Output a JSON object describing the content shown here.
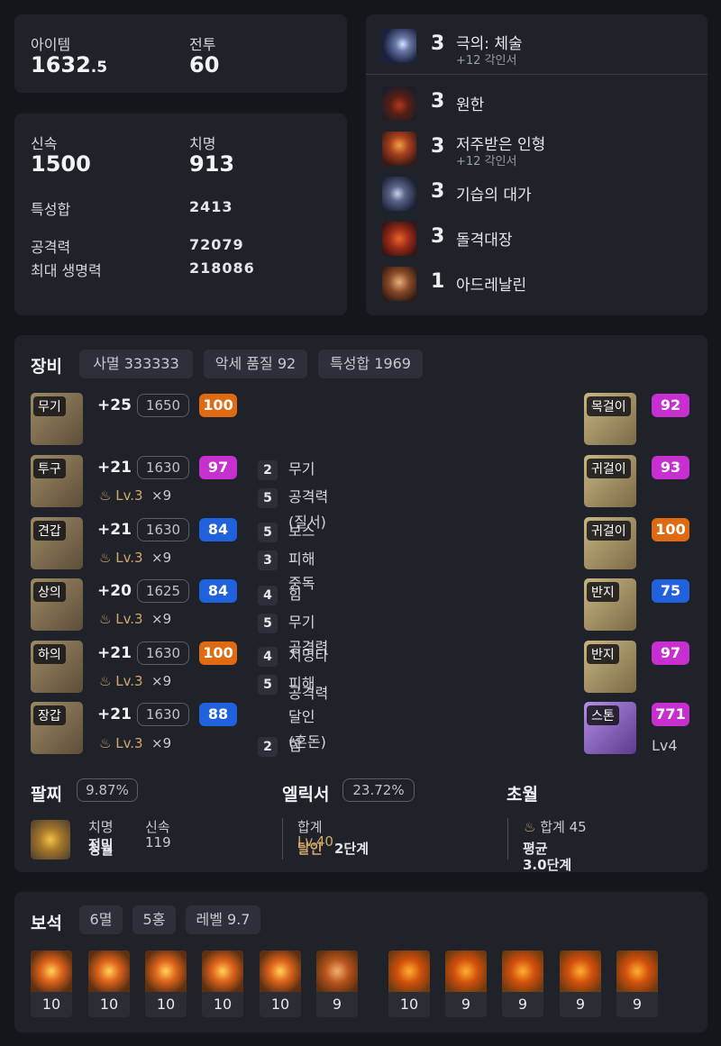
{
  "summary": {
    "item_label": "아이템",
    "item_value": "1632",
    "item_decimal": ".5",
    "combat_label": "전투",
    "combat_value": "60"
  },
  "stats": {
    "swift_label": "신속",
    "swift_value": "1500",
    "crit_label": "치명",
    "crit_value": "913",
    "trait_label": "특성합",
    "trait_value": "2413",
    "atk_label": "공격력",
    "atk_value": "72079",
    "hp_label": "최대 생명력",
    "hp_value": "218086"
  },
  "engravings": [
    {
      "level": "3",
      "name": "극의: 체술",
      "sub": "+12 각인서",
      "icon": "martial-arts-icon"
    },
    {
      "level": "3",
      "name": "원한",
      "sub": "",
      "icon": "grudge-icon"
    },
    {
      "level": "3",
      "name": "저주받은 인형",
      "sub": "+12 각인서",
      "icon": "cursed-doll-icon"
    },
    {
      "level": "3",
      "name": "기습의 대가",
      "sub": "",
      "icon": "ambush-icon"
    },
    {
      "level": "3",
      "name": "돌격대장",
      "sub": "",
      "icon": "charge-icon"
    },
    {
      "level": "1",
      "name": "아드레날린",
      "sub": "",
      "icon": "adrenaline-icon"
    }
  ],
  "equipment": {
    "title": "장비",
    "chips": [
      "사멸 333333",
      "악세 품질 92",
      "특성합 1969"
    ],
    "armor": [
      {
        "slot": "무기",
        "enhance": "+25",
        "ilvl": "1650",
        "quality": "100",
        "elixir": "",
        "count": ""
      },
      {
        "slot": "투구",
        "enhance": "+21",
        "ilvl": "1630",
        "quality": "97",
        "elixir": "Lv.3",
        "count": "×9"
      },
      {
        "slot": "견갑",
        "enhance": "+21",
        "ilvl": "1630",
        "quality": "84",
        "elixir": "Lv.3",
        "count": "×9"
      },
      {
        "slot": "상의",
        "enhance": "+20",
        "ilvl": "1625",
        "quality": "84",
        "elixir": "Lv.3",
        "count": "×9"
      },
      {
        "slot": "하의",
        "enhance": "+21",
        "ilvl": "1630",
        "quality": "100",
        "elixir": "Lv.3",
        "count": "×9"
      },
      {
        "slot": "장갑",
        "enhance": "+21",
        "ilvl": "1630",
        "quality": "88",
        "elixir": "Lv.3",
        "count": "×9"
      }
    ],
    "effects": [
      {
        "lv": "2",
        "name": "무기"
      },
      {
        "lv": "5",
        "name": "공격력"
      },
      {
        "lv": "",
        "name": "(질서)"
      },
      {
        "lv": "5",
        "name": "보스"
      },
      {
        "lv": "3",
        "name": "피해"
      },
      {
        "lv": "",
        "name": "중독"
      },
      {
        "lv": "4",
        "name": "힘"
      },
      {
        "lv": "5",
        "name": "무기"
      },
      {
        "lv": "",
        "name": "공격력"
      },
      {
        "lv": "4",
        "name": "치명타"
      },
      {
        "lv": "5",
        "name": "피해"
      },
      {
        "lv": "",
        "name": "공격력"
      },
      {
        "lv": "5",
        "name": "달인"
      },
      {
        "lv": "2",
        "name": "(혼돈)"
      },
      {
        "lv": "",
        "name": "힘"
      }
    ],
    "accessories": [
      {
        "slot": "목걸이",
        "quality": "92"
      },
      {
        "slot": "귀걸이",
        "quality": "93"
      },
      {
        "slot": "귀걸이",
        "quality": "100"
      },
      {
        "slot": "반지",
        "quality": "75"
      },
      {
        "slot": "반지",
        "quality": "97"
      },
      {
        "slot": "스톤",
        "quality": "771",
        "extra": "Lv4"
      }
    ]
  },
  "bracelet": {
    "title": "팔찌",
    "pct": "9.87%",
    "stat1": "치명",
    "stat2": "신속",
    "stat2_val": "119",
    "line2a": "정밀",
    "line2b": "청월"
  },
  "elixir": {
    "title": "엘릭서",
    "pct": "23.72%",
    "sum_label": "합계",
    "sum_val": "Lv.40",
    "sum_overlap": "달인",
    "step": "2단계"
  },
  "transcend": {
    "title": "초월",
    "sum": "합계 45",
    "avg_label": "평균",
    "avg_val": "3.0단계"
  },
  "gems": {
    "title": "보석",
    "chips": [
      "6멸",
      "5홍",
      "레벨 9.7"
    ],
    "items": [
      {
        "type": "doom",
        "level": "10"
      },
      {
        "type": "doom",
        "level": "10"
      },
      {
        "type": "doom",
        "level": "10"
      },
      {
        "type": "doom",
        "level": "10"
      },
      {
        "type": "doom",
        "level": "10"
      },
      {
        "type": "doom",
        "level": "9"
      },
      {
        "type": "crimson",
        "level": "10"
      },
      {
        "type": "crimson",
        "level": "9"
      },
      {
        "type": "crimson",
        "level": "9"
      },
      {
        "type": "crimson",
        "level": "9"
      },
      {
        "type": "crimson",
        "level": "9"
      }
    ]
  }
}
